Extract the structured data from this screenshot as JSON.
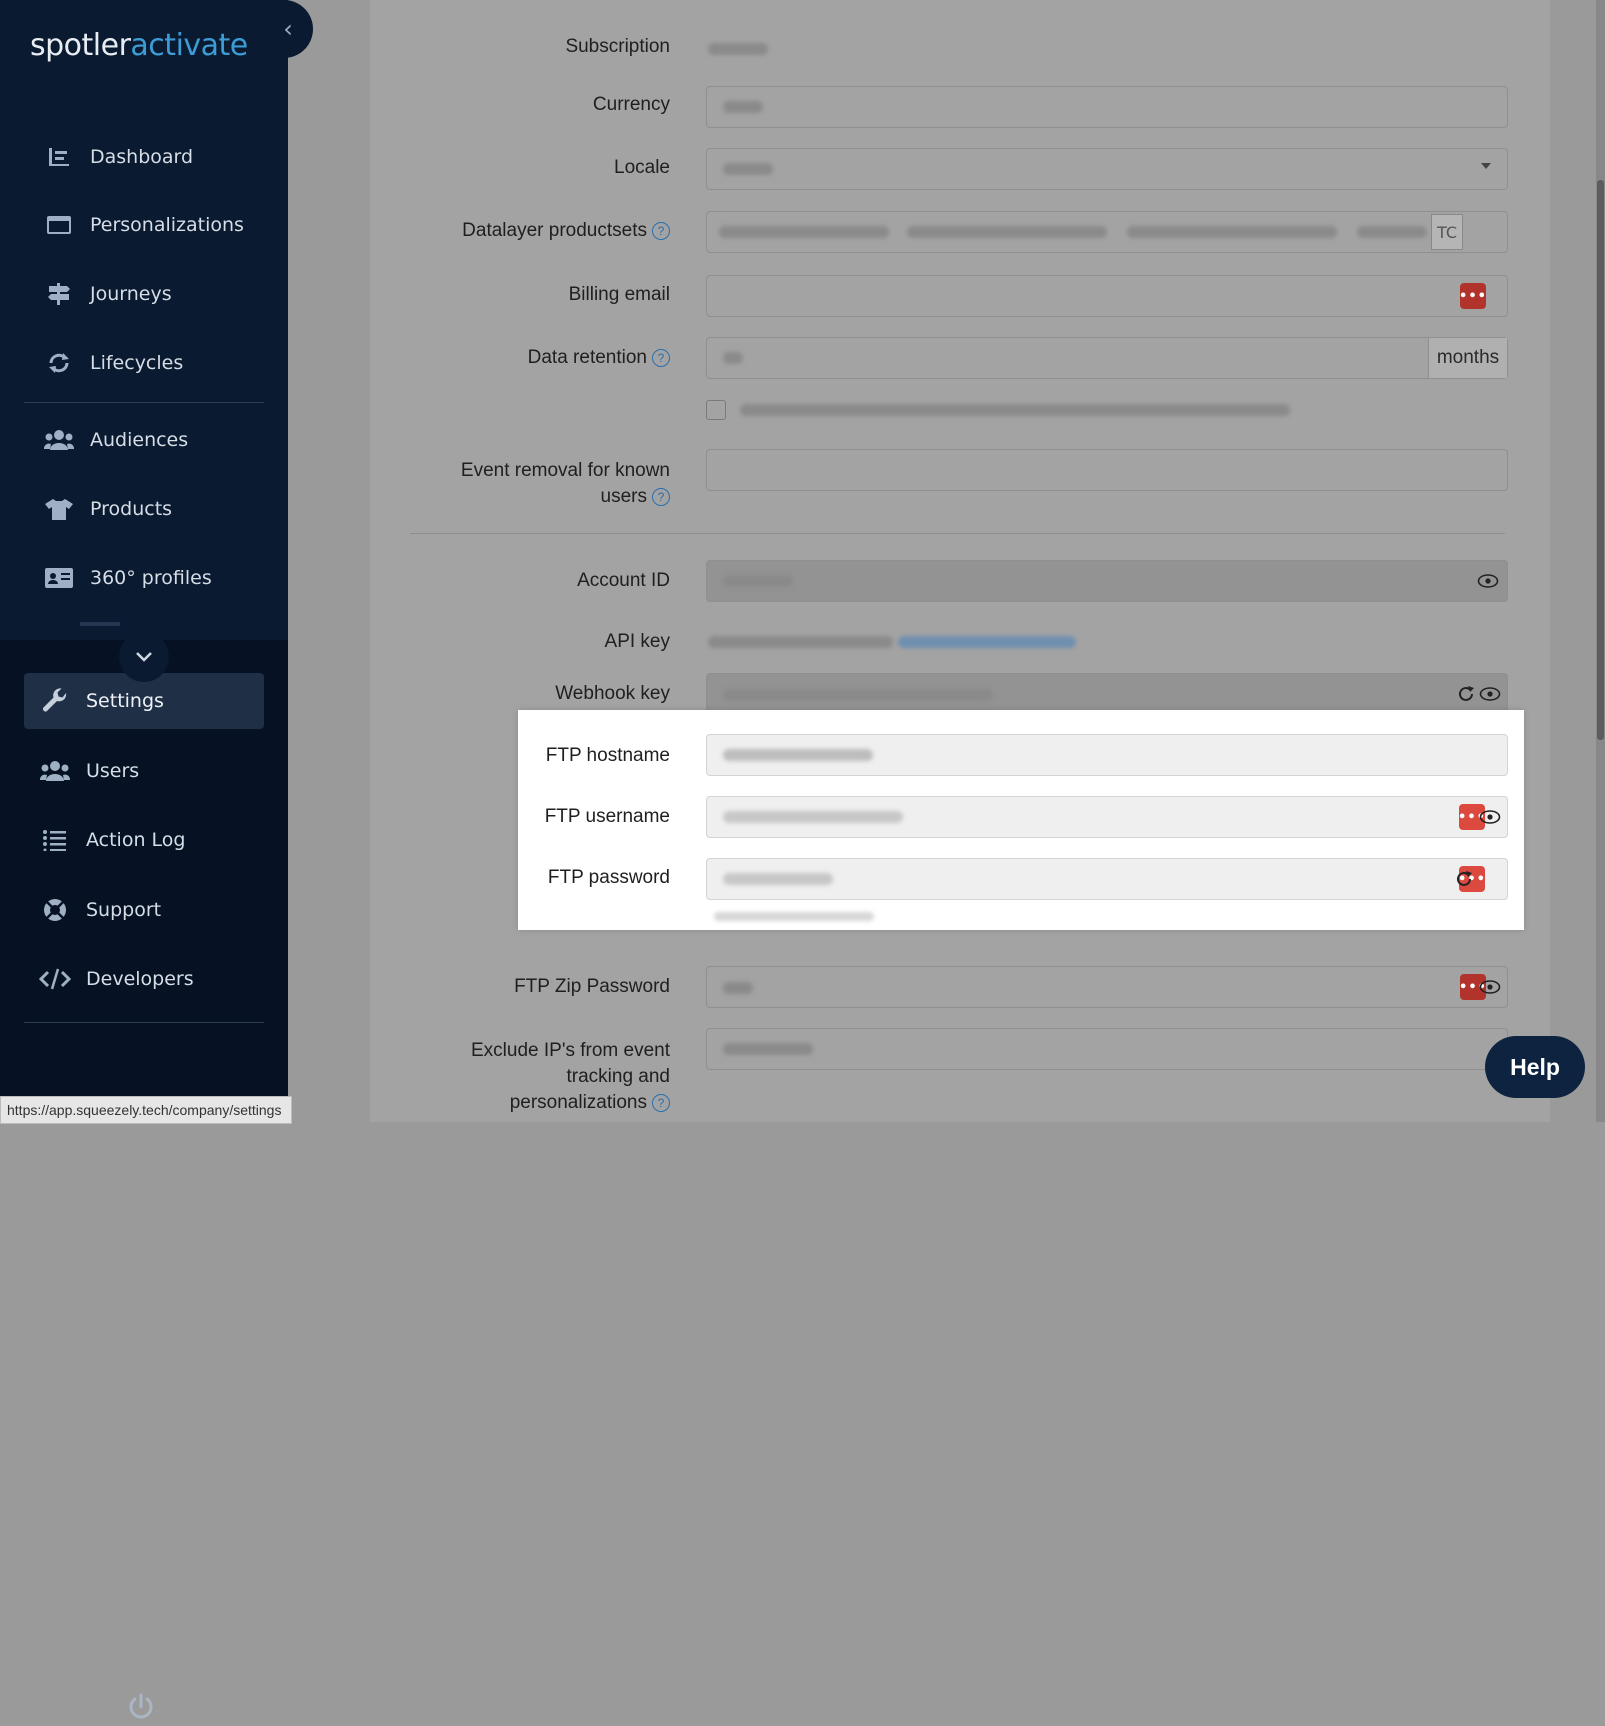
{
  "sidebar": {
    "logo_part1": "spotler",
    "logo_part2": "activate",
    "items": [
      {
        "label": "Dashboard"
      },
      {
        "label": "Personalizations"
      },
      {
        "label": "Journeys"
      },
      {
        "label": "Lifecycles"
      },
      {
        "label": "Audiences"
      },
      {
        "label": "Products"
      },
      {
        "label": "360° profiles"
      },
      {
        "label": "Settings"
      },
      {
        "label": "Users"
      },
      {
        "label": "Action Log"
      },
      {
        "label": "Support"
      },
      {
        "label": "Developers"
      }
    ],
    "active": "Settings"
  },
  "form": {
    "subscription_label": "Subscription",
    "currency_label": "Currency",
    "locale_label": "Locale",
    "datalayer_label": "Datalayer productsets",
    "datalayer_suffix": "TC",
    "billing_email_label": "Billing email",
    "data_retention_label": "Data retention",
    "data_retention_unit": "months",
    "event_removal_label_line1": "Event removal for known",
    "event_removal_label_line2": "users",
    "account_id_label": "Account ID",
    "api_key_label": "API key",
    "webhook_key_label": "Webhook key",
    "ftp_hostname_label": "FTP hostname",
    "ftp_username_label": "FTP username",
    "ftp_password_label": "FTP password",
    "ftp_zip_password_label": "FTP Zip Password",
    "exclude_ip_line1": "Exclude IP's from event",
    "exclude_ip_line2": "tracking and",
    "exclude_ip_line3": "personalizations"
  },
  "help_button": "Help",
  "status_url": "https://app.squeezely.tech/company/settings",
  "colors": {
    "sidebar_bg": "#0a1a30",
    "accent": "#3d9bd6",
    "danger": "#b2332b"
  }
}
